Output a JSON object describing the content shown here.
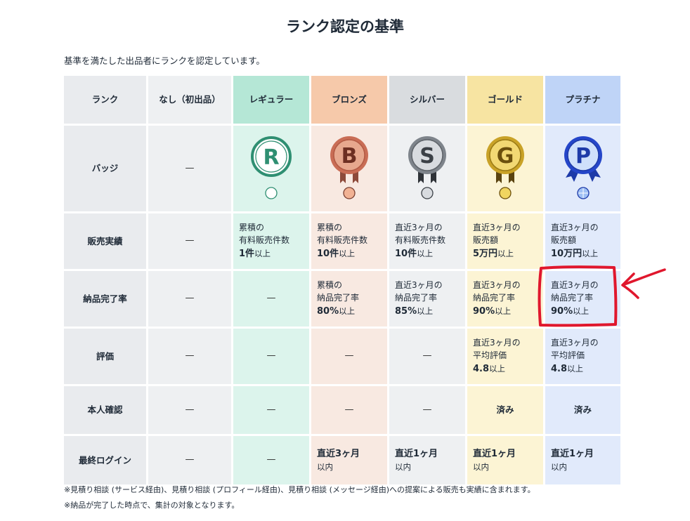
{
  "page": {
    "title": "ランク認定の基準",
    "intro": "基準を満たした出品者にランクを認定しています。"
  },
  "table": {
    "headers": [
      "ランク",
      "なし（初出品）",
      "レギュラー",
      "ブロンズ",
      "シルバー",
      "ゴールド",
      "プラチナ"
    ],
    "row_labels": {
      "badge": "バッジ",
      "sales": "販売実績",
      "delivery": "納品完了率",
      "rating": "評価",
      "identity": "本人確認",
      "login": "最終ログイン"
    },
    "dash": "—",
    "badges": {
      "regular": "R",
      "bronze": "B",
      "silver": "S",
      "gold": "G",
      "platinum": "P"
    },
    "sales": {
      "regular": {
        "l1": "累積の",
        "l2": "有料販売件数",
        "value": "1件",
        "suffix": "以上"
      },
      "bronze": {
        "l1": "累積の",
        "l2": "有料販売件数",
        "value": "10件",
        "suffix": "以上"
      },
      "silver": {
        "l1": "直近3ヶ月の",
        "l2": "有料販売件数",
        "value": "10件",
        "suffix": "以上"
      },
      "gold": {
        "l1": "直近3ヶ月の",
        "l2": "販売額",
        "value": "5万円",
        "suffix": "以上"
      },
      "platinum": {
        "l1": "直近3ヶ月の",
        "l2": "販売額",
        "value": "10万円",
        "suffix": "以上"
      }
    },
    "delivery": {
      "bronze": {
        "l1": "累積の",
        "l2": "納品完了率",
        "value": "80%",
        "suffix": "以上"
      },
      "silver": {
        "l1": "直近3ヶ月の",
        "l2": "納品完了率",
        "value": "85%",
        "suffix": "以上"
      },
      "gold": {
        "l1": "直近3ヶ月の",
        "l2": "納品完了率",
        "value": "90%",
        "suffix": "以上"
      },
      "platinum": {
        "l1": "直近3ヶ月の",
        "l2": "納品完了率",
        "value": "90%",
        "suffix": "以上"
      }
    },
    "rating": {
      "gold": {
        "l1": "直近3ヶ月の",
        "l2": "平均評価",
        "value": "4.8",
        "suffix": "以上"
      },
      "platinum": {
        "l1": "直近3ヶ月の",
        "l2": "平均評価",
        "value": "4.8",
        "suffix": "以上"
      }
    },
    "identity": {
      "gold": "済み",
      "platinum": "済み"
    },
    "login": {
      "bronze": {
        "value": "直近3ヶ月",
        "suffix": "以内"
      },
      "silver": {
        "value": "直近1ヶ月",
        "suffix": "以内"
      },
      "gold": {
        "value": "直近1ヶ月",
        "suffix": "以内"
      },
      "platinum": {
        "value": "直近1ヶ月",
        "suffix": "以内"
      }
    }
  },
  "notes": [
    "※見積り相談 (サービス経由)、見積り相談 (プロフィール経由)、見積り相談 (メッセージ経由)への提案による販売も実績に含まれます。",
    "※納品が完了した時点で、集計の対象となります。"
  ],
  "colors": {
    "regular": "#2f8f72",
    "bronze": "#c96d55",
    "silver": "#7e848b",
    "gold": "#c9a227",
    "platinum": "#2546c9",
    "highlight": "#e0172d"
  }
}
